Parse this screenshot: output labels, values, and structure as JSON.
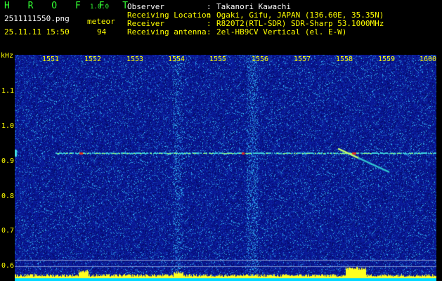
{
  "app": {
    "title": "H R O F F T",
    "version": "1.0.0"
  },
  "file_name": "2511111550.png",
  "mode_label": "meteor",
  "date_time": "25.11.11 15:50",
  "count_value": "94",
  "info": [
    {
      "key": "Observer",
      "value": "Takanori Kawachi"
    },
    {
      "key": "Receiving Location",
      "value": "Ogaki, Gifu, JAPAN (136.60E, 35.35N)"
    },
    {
      "key": "Receiver",
      "value": "R820T2(RTL-SDR) SDR-Sharp 53.1000MHz"
    },
    {
      "key": "Receiving antenna",
      "value": "2el-HB9CV Vertical (el. E-W)"
    }
  ],
  "info_separator": ":",
  "axis": {
    "unit": "kHz",
    "time_ticks": [
      "1551",
      "1552",
      "1553",
      "1554",
      "1555",
      "1556",
      "1557",
      "1558",
      "1559",
      "1600"
    ],
    "freq_ticks": [
      "1.1",
      "1.0",
      "0.9",
      "0.8",
      "0.7",
      "0.6"
    ]
  },
  "colors": {
    "background": "#000000",
    "spectrogram_base": "#0a1b9a",
    "header_green": "#33ff33",
    "header_yellow": "#ffff00",
    "header_white": "#ffffff"
  }
}
